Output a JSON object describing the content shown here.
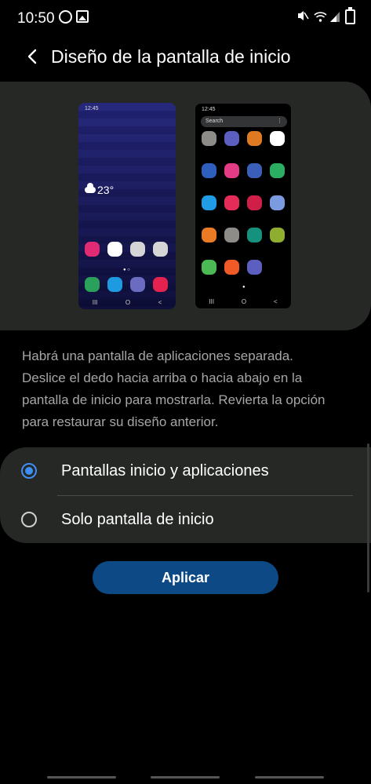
{
  "status_bar": {
    "time": "10:50",
    "icons": [
      "whatsapp-icon",
      "gallery-icon",
      "mute-icon",
      "wifi-icon",
      "signal-icon",
      "battery-charging-icon"
    ]
  },
  "header": {
    "title": "Diseño de la pantalla de inicio"
  },
  "preview": {
    "phone1": {
      "time": "12:45",
      "temperature": "23°"
    },
    "phone2": {
      "time": "12:45",
      "search_label": "Search",
      "menu_glyph": "⋮"
    },
    "nav_glyphs": [
      "III",
      "O",
      "<"
    ],
    "phone1_icon_colors": [
      "#e12a74",
      "#ffffff",
      "#d5d5d5",
      "#d5d5d5",
      "#2aa05b",
      "#1e9be0",
      "#6b6bc2",
      "#e3224f"
    ],
    "phone2_icon_colors": [
      "#8e8c88",
      "#5c5fbf",
      "#e07a22",
      "#ffffff",
      "#2f5fbd",
      "#e33b85",
      "#3b5fb8",
      "#2bad62",
      "#209be5",
      "#e32d58",
      "#cf1f48",
      "#7a9be0",
      "#ea7a24",
      "#8e8c88",
      "#15927e",
      "#8fae2f",
      "#4bb954",
      "#ef5a26",
      "#5c5fbf"
    ]
  },
  "description": "Habrá una pantalla de aplicaciones separada. Deslice el dedo hacia arriba o hacia abajo en la pantalla de inicio para mostrarla. Revierta la opción para restaurar su diseño anterior.",
  "options": [
    {
      "label": "Pantallas inicio y aplicaciones",
      "selected": true
    },
    {
      "label": "Solo pantalla de inicio",
      "selected": false
    }
  ],
  "apply_button": {
    "label": "Aplicar"
  },
  "colors": {
    "accent": "#3e8ef5",
    "button": "#0d4a85",
    "card": "#262826"
  }
}
